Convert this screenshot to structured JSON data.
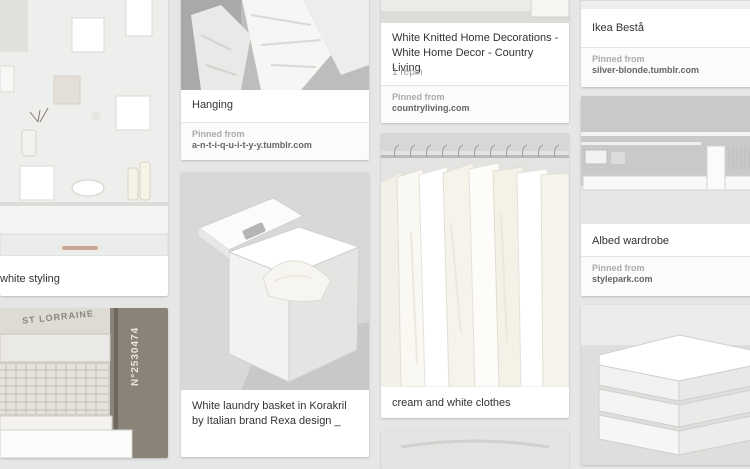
{
  "pins": [
    {
      "description": "white styling"
    },
    {
      "description": "Hanging",
      "attribution": {
        "label": "Pinned from",
        "source": "a-n-t-i-q-u-i-t-y-y.tumblr.com"
      }
    },
    {
      "description": "White laundry basket in Korakril by Italian brand Rexa design _"
    },
    {
      "description": "White Knitted Home Decorations - White Home Decor - Country Living",
      "repins": "1 repin",
      "attribution": {
        "label": "Pinned from",
        "source": "countryliving.com"
      }
    },
    {
      "description": "cream and white clothes"
    },
    {
      "description": "Ikea Bestå",
      "attribution": {
        "label": "Pinned from",
        "source": "silver-blonde.tumblr.com"
      }
    },
    {
      "description": "Albed wardrobe",
      "attribution": {
        "label": "Pinned from",
        "source": "stylepark.com"
      }
    }
  ],
  "image_text": {
    "crate_top": "ST LORRAINE",
    "crate_side": "N°2530474"
  }
}
